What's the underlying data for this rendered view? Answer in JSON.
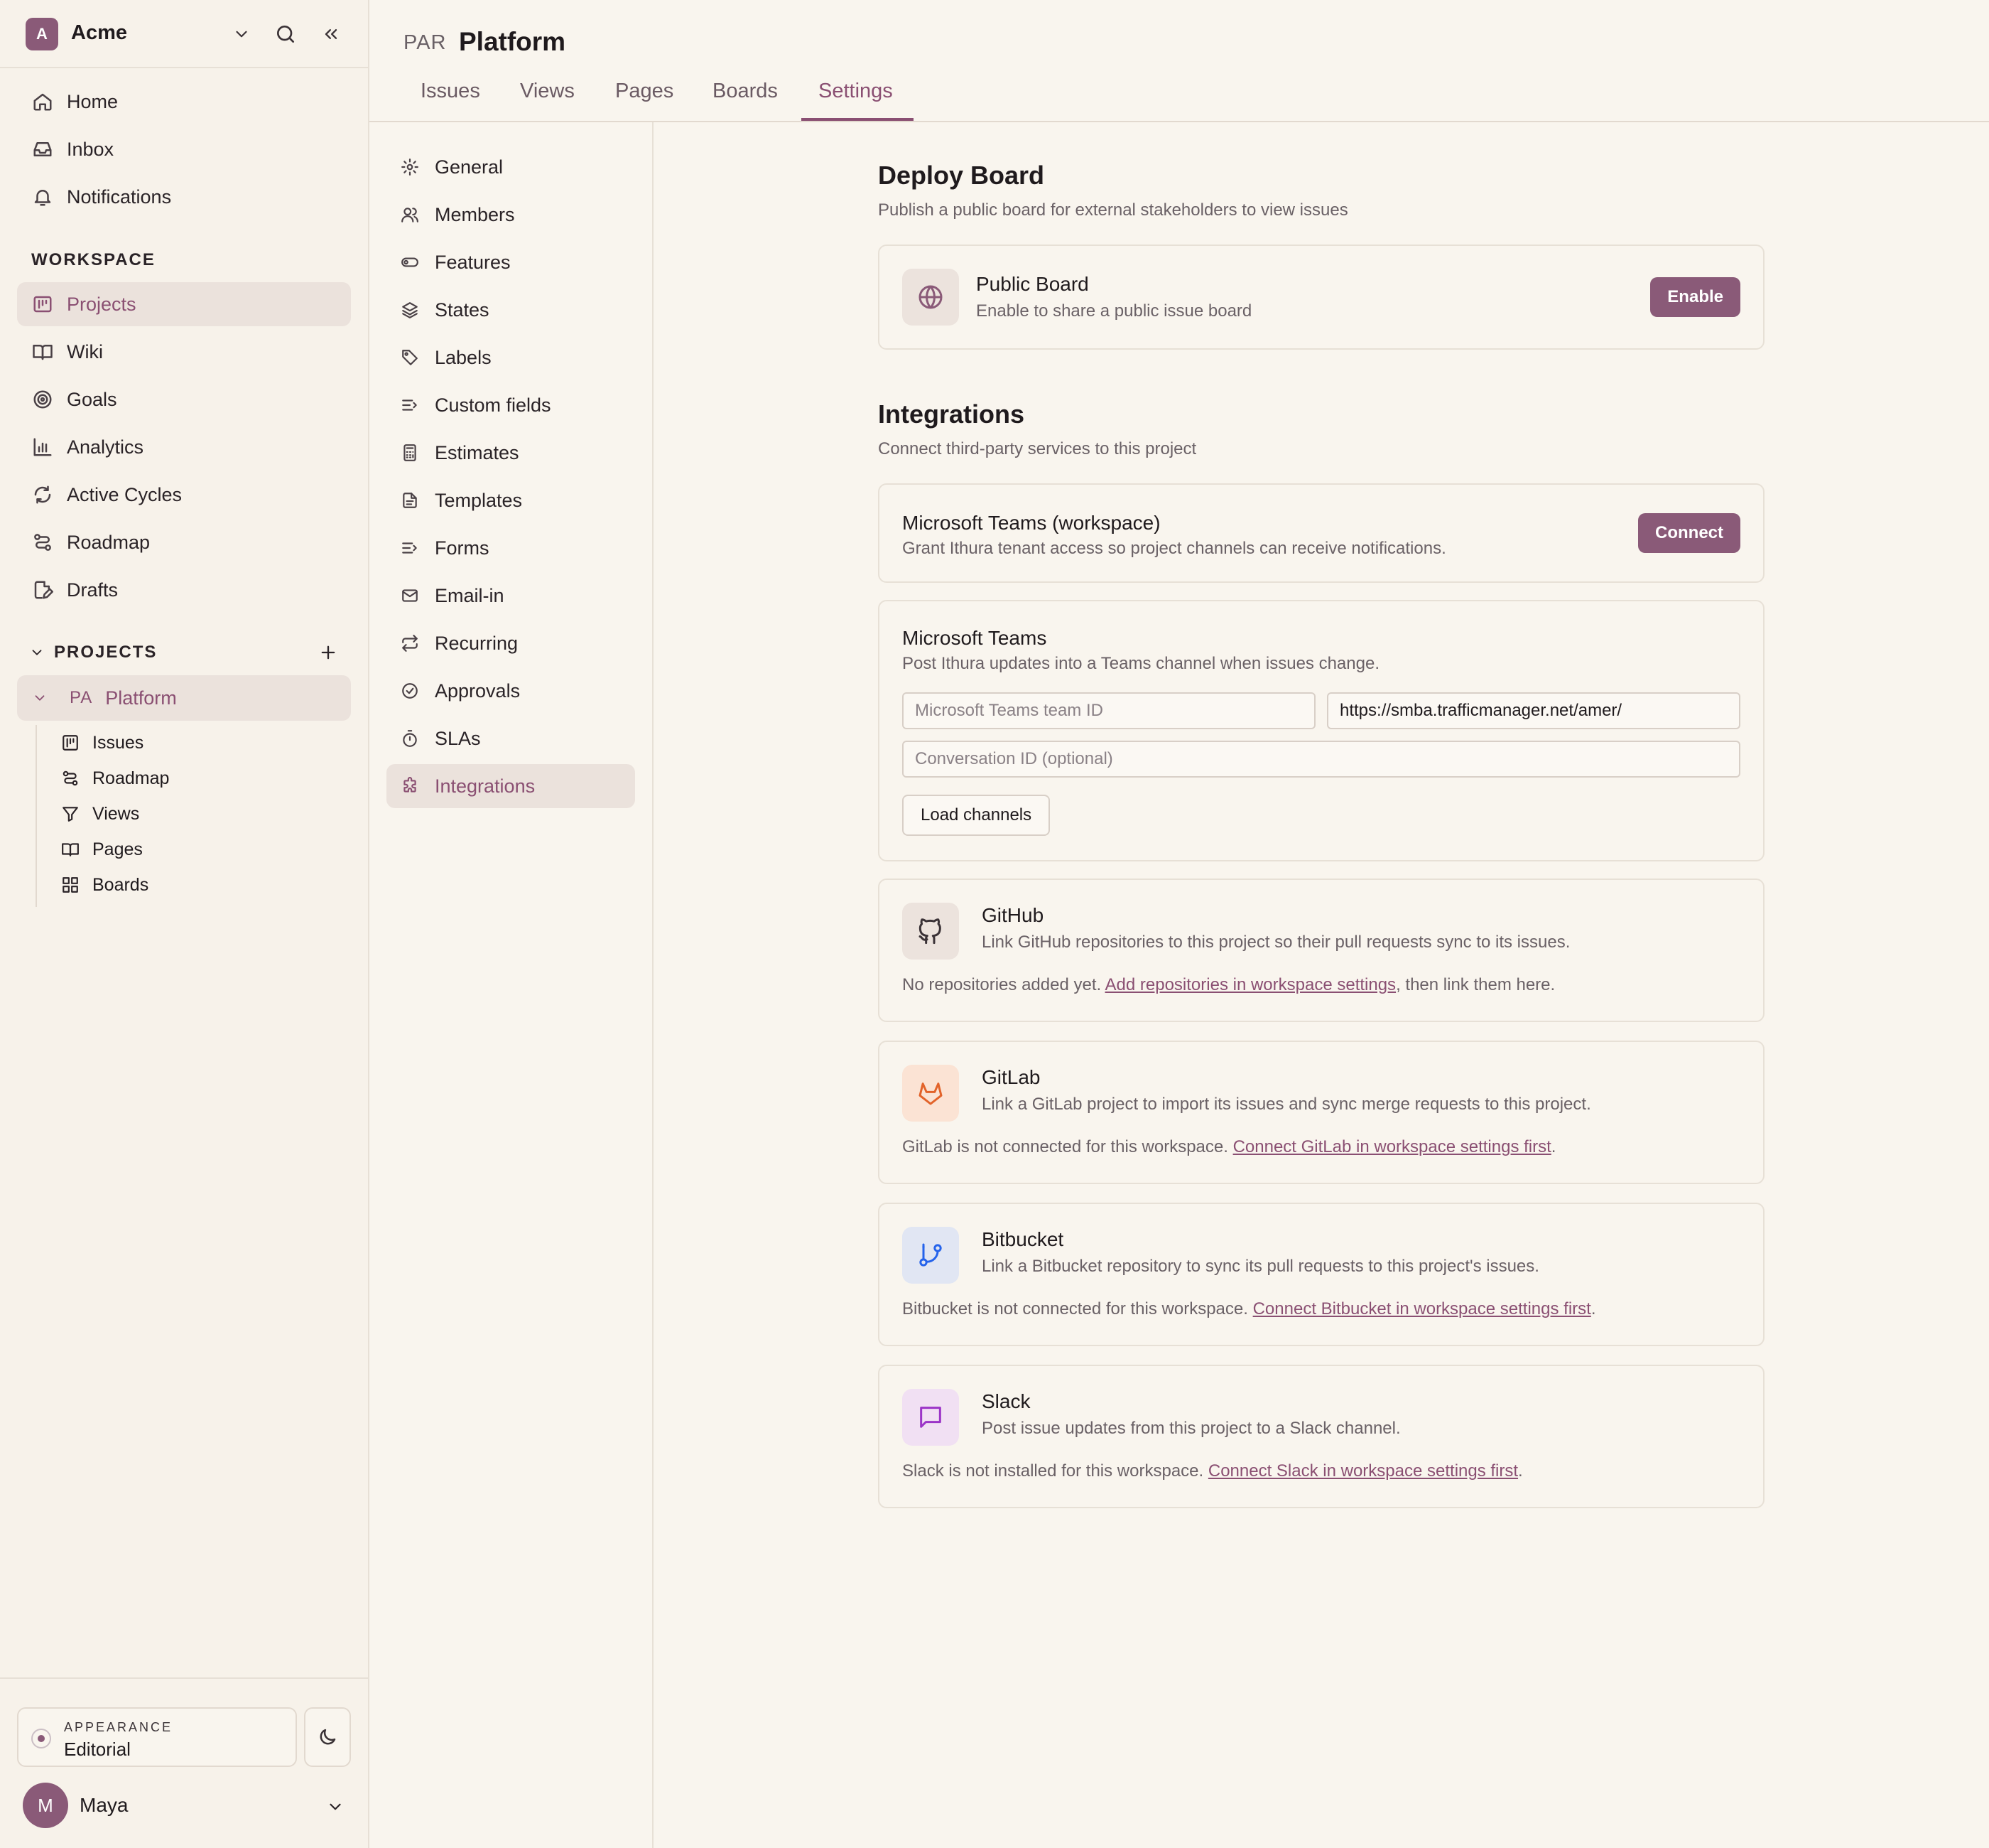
{
  "workspace": {
    "initial": "A",
    "name": "Acme"
  },
  "nav": [
    {
      "label": "Home"
    },
    {
      "label": "Inbox"
    },
    {
      "label": "Notifications"
    }
  ],
  "workspace_section": {
    "label": "WORKSPACE",
    "items": [
      {
        "label": "Projects"
      },
      {
        "label": "Wiki"
      },
      {
        "label": "Goals"
      },
      {
        "label": "Analytics"
      },
      {
        "label": "Active Cycles"
      },
      {
        "label": "Roadmap"
      },
      {
        "label": "Drafts"
      }
    ]
  },
  "projects_section": {
    "label": "PROJECTS",
    "project": {
      "code": "PA",
      "name": "Platform"
    },
    "sub_items": [
      {
        "label": "Issues"
      },
      {
        "label": "Roadmap"
      },
      {
        "label": "Views"
      },
      {
        "label": "Pages"
      },
      {
        "label": "Boards"
      }
    ]
  },
  "appearance": {
    "label": "APPEARANCE",
    "value": "Editorial"
  },
  "user": {
    "initial": "M",
    "name": "Maya"
  },
  "header": {
    "code": "PAR",
    "title": "Platform",
    "tabs": [
      {
        "label": "Issues"
      },
      {
        "label": "Views"
      },
      {
        "label": "Pages"
      },
      {
        "label": "Boards"
      },
      {
        "label": "Settings"
      }
    ]
  },
  "settings_nav": [
    {
      "label": "General"
    },
    {
      "label": "Members"
    },
    {
      "label": "Features"
    },
    {
      "label": "States"
    },
    {
      "label": "Labels"
    },
    {
      "label": "Custom fields"
    },
    {
      "label": "Estimates"
    },
    {
      "label": "Templates"
    },
    {
      "label": "Forms"
    },
    {
      "label": "Email-in"
    },
    {
      "label": "Recurring"
    },
    {
      "label": "Approvals"
    },
    {
      "label": "SLAs"
    },
    {
      "label": "Integrations"
    }
  ],
  "deploy": {
    "title": "Deploy Board",
    "subtitle": "Publish a public board for external stakeholders to view issues",
    "card_title": "Public Board",
    "card_desc": "Enable to share a public issue board",
    "button": "Enable"
  },
  "integrations": {
    "title": "Integrations",
    "subtitle": "Connect third-party services to this project",
    "teams_ws": {
      "title": "Microsoft Teams (workspace)",
      "desc": "Grant Ithura tenant access so project channels can receive notifications.",
      "button": "Connect"
    },
    "teams": {
      "title": "Microsoft Teams",
      "desc": "Post Ithura updates into a Teams channel when issues change.",
      "team_id_placeholder": "Microsoft Teams team ID",
      "service_url_value": "https://smba.trafficmanager.net/amer/",
      "conversation_placeholder": "Conversation ID (optional)",
      "button": "Load channels"
    },
    "github": {
      "title": "GitHub",
      "desc": "Link GitHub repositories to this project so their pull requests sync to its issues.",
      "note_pre": "No repositories added yet. ",
      "note_link": "Add repositories in workspace settings",
      "note_post": ", then link them here."
    },
    "gitlab": {
      "title": "GitLab",
      "desc": "Link a GitLab project to import its issues and sync merge requests to this project.",
      "note_pre": "GitLab is not connected for this workspace. ",
      "note_link": "Connect GitLab in workspace settings first",
      "note_post": "."
    },
    "bitbucket": {
      "title": "Bitbucket",
      "desc": "Link a Bitbucket repository to sync its pull requests to this project's issues.",
      "note_pre": "Bitbucket is not connected for this workspace. ",
      "note_link": "Connect Bitbucket in workspace settings first",
      "note_post": "."
    },
    "slack": {
      "title": "Slack",
      "desc": "Post issue updates from this project to a Slack channel.",
      "note_pre": "Slack is not installed for this workspace. ",
      "note_link": "Connect Slack in workspace settings first",
      "note_post": "."
    }
  },
  "colors": {
    "accent": "#8a5a78",
    "accent_text": "#8a4f72",
    "background": "#f9f5ee",
    "gitlab": "#e2632a",
    "bitbucket": "#2563eb",
    "slack": "#9b34c7"
  }
}
